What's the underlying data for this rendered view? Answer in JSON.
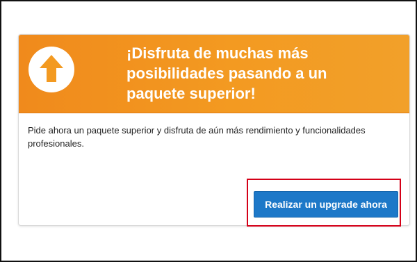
{
  "banner": {
    "title": "¡Disfruta de muchas más posibilidades pasando a un paquete superior!",
    "icon": "arrow-up-icon",
    "background_color": "#f39a21"
  },
  "content": {
    "description": "Pide ahora un paquete superior y disfruta de aún más rendimiento y funcionalidades profesionales."
  },
  "actions": {
    "upgrade_label": "Realizar un upgrade ahora",
    "button_color": "#1d78c8",
    "highlight_color": "#d40018"
  }
}
